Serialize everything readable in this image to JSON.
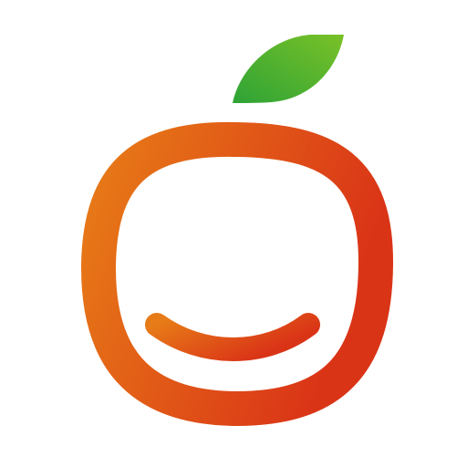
{
  "logo": {
    "icon": "orange-fruit-smile-icon",
    "colors": {
      "background": "#ffffff",
      "body_gradient_start": "#e77b17",
      "body_gradient_end": "#da3417",
      "leaf_gradient_start": "#2ea336",
      "leaf_gradient_end": "#79c127"
    }
  }
}
